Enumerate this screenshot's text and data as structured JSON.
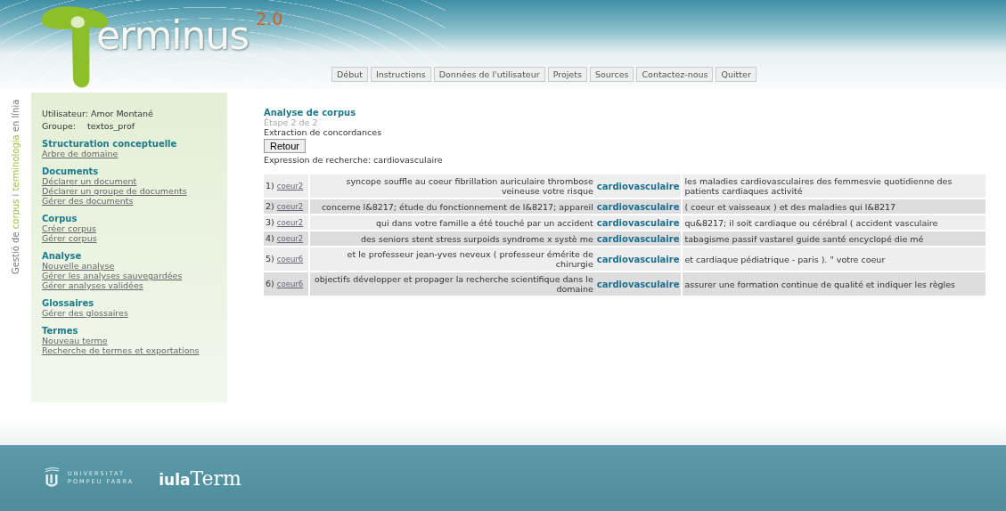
{
  "header": {
    "logo_text": "erminus",
    "version": "2.0"
  },
  "nav": [
    {
      "label": "Début"
    },
    {
      "label": "Instructions"
    },
    {
      "label": "Données de l'utilisateur"
    },
    {
      "label": "Projets"
    },
    {
      "label": "Sources"
    },
    {
      "label": "Contactez-nous"
    },
    {
      "label": "Quitter"
    }
  ],
  "tagline": [
    {
      "text": "Gestió de ",
      "highlight": false
    },
    {
      "text": "corpus",
      "highlight": true
    },
    {
      "text": " i ",
      "highlight": false
    },
    {
      "text": "terminologia",
      "highlight": true
    },
    {
      "text": " en línia",
      "highlight": false
    }
  ],
  "user": {
    "user_label": "Utilisateur:",
    "user": "Amor Montané",
    "group_label": "Groupe:",
    "group": "textos_prof"
  },
  "sidebar": [
    {
      "title": "Structuration conceptuelle",
      "links": [
        "Arbre de domaine"
      ]
    },
    {
      "title": "Documents",
      "links": [
        "Déclarer un document",
        "Déclarer un groupe de documents",
        "Gérer des documents"
      ]
    },
    {
      "title": "Corpus",
      "links": [
        "Créer corpus",
        "Gérer corpus"
      ]
    },
    {
      "title": "Analyse",
      "links": [
        "Nouvelle analyse",
        "Gérer les analyses sauvegardées",
        "Gérer analyses validées"
      ]
    },
    {
      "title": "Glossaires",
      "links": [
        "Gérer des glossaires"
      ]
    },
    {
      "title": "Termes",
      "links": [
        "Nouveau terme",
        "Recherche de termes et exportations"
      ]
    }
  ],
  "main": {
    "title": "Analyse de corpus",
    "step": "Étape 2 de 2",
    "subtitle": "Extraction de concordances",
    "back_button": "Retour",
    "search_expression": "Expression de recherche: cardiovasculaire"
  },
  "rows": [
    {
      "num": "1)",
      "source": "coeur2",
      "left": "syncope souffle au coeur fibrillation auriculaire thrombose veineuse votre risque",
      "keyword": "cardiovasculaire",
      "right": "les maladies cardiovasculaires des femmesvie quotidienne des patients cardiaques activité"
    },
    {
      "num": "2)",
      "source": "coeur2",
      "left": "concerne l&8217; étude du fonctionnement de l&8217; appareil",
      "keyword": "cardiovasculaire",
      "right": "( coeur et vaisseaux ) et des maladies qui l&8217"
    },
    {
      "num": "3)",
      "source": "coeur2",
      "left": "qui dans votre famille a été touché par un accident",
      "keyword": "cardiovasculaire",
      "right": "qu&8217; il soit cardiaque ou cérébral ( accident vasculaire"
    },
    {
      "num": "4)",
      "source": "coeur2",
      "left": "des seniors stent stress surpoids syndrome x systè me",
      "keyword": "cardiovasculaire",
      "right": "tabagisme passif vastarel guide santé encyclopé die mé"
    },
    {
      "num": "5)",
      "source": "coeur6",
      "left": "et le professeur jean-yves neveux ( professeur émérite de chirurgie",
      "keyword": "cardiovasculaire",
      "right": "et cardiaque pédiatrique - paris ). \" votre coeur"
    },
    {
      "num": "6)",
      "source": "coeur6",
      "left": "objectifs développer et propager la recherche scientifique dans le domaine",
      "keyword": "cardiovasculaire",
      "right": "assurer une formation continue de qualité et indiquer les règles"
    }
  ],
  "footer": {
    "university": [
      "UNIVERSITAT",
      "POMPEU FABRA"
    ],
    "iula": "iula",
    "term": "Term"
  }
}
